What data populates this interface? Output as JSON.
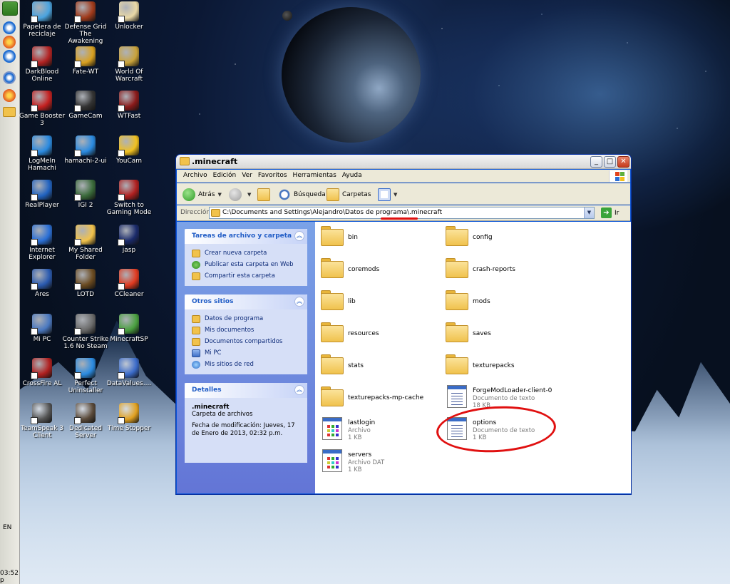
{
  "desktop": {
    "icons": [
      {
        "label": "Papelera de reciclaje",
        "icon": "recycle-bin-icon"
      },
      {
        "label": "Defense Grid The Awakening",
        "icon": "defense-grid-icon"
      },
      {
        "label": "Unlocker",
        "icon": "unlocker-icon"
      },
      {
        "label": "DarkBlood Online",
        "icon": "darkblood-icon"
      },
      {
        "label": "Fate-WT",
        "icon": "fate-icon"
      },
      {
        "label": "World Of Warcraft",
        "icon": "wow-icon"
      },
      {
        "label": "Game Booster 3",
        "icon": "game-booster-icon"
      },
      {
        "label": "GameCam",
        "icon": "gamecam-icon"
      },
      {
        "label": "WTFast",
        "icon": "wtfast-icon"
      },
      {
        "label": "LogMeIn Hamachi",
        "icon": "hamachi-icon"
      },
      {
        "label": "hamachi-2-ui",
        "icon": "hamachi-ui-icon"
      },
      {
        "label": "YouCam",
        "icon": "youcam-icon"
      },
      {
        "label": "RealPlayer",
        "icon": "realplayer-icon"
      },
      {
        "label": "IGI 2",
        "icon": "igi2-icon"
      },
      {
        "label": "Switch to Gaming Mode",
        "icon": "gaming-mode-icon"
      },
      {
        "label": "Internet Explorer",
        "icon": "ie-icon"
      },
      {
        "label": "My Shared Folder",
        "icon": "shared-folder-icon"
      },
      {
        "label": "jasp",
        "icon": "jasp-icon"
      },
      {
        "label": "Ares",
        "icon": "ares-icon"
      },
      {
        "label": "LOTD",
        "icon": "lotd-icon"
      },
      {
        "label": "CCleaner",
        "icon": "ccleaner-icon"
      },
      {
        "label": "Mi PC",
        "icon": "my-computer-icon"
      },
      {
        "label": "Counter Strike 1.6 No Steam",
        "icon": "counter-strike-icon"
      },
      {
        "label": "MinecraftSP",
        "icon": "minecraft-icon"
      },
      {
        "label": "CrossFire AL",
        "icon": "crossfire-icon"
      },
      {
        "label": "Perfect Uninstaller",
        "icon": "uninstaller-icon"
      },
      {
        "label": "DataValues....",
        "icon": "datavalues-icon"
      },
      {
        "label": "TeamSpeak 3 Client",
        "icon": "teamspeak-icon"
      },
      {
        "label": "Dedicated Server",
        "icon": "dedicated-server-icon"
      },
      {
        "label": "Time Stopper",
        "icon": "time-stopper-icon"
      }
    ]
  },
  "quicklaunch": {
    "lang": "EN",
    "time": "03:52 p"
  },
  "window": {
    "title": ".minecraft",
    "menu": [
      "Archivo",
      "Edición",
      "Ver",
      "Favoritos",
      "Herramientas",
      "Ayuda"
    ],
    "toolbar": {
      "back": "Atrás",
      "search": "Búsqueda",
      "folders": "Carpetas"
    },
    "address": {
      "label": "Dirección",
      "path": "C:\\Documents and Settings\\Alejandro\\Datos de programa\\.minecraft",
      "go": "Ir"
    },
    "tasks": {
      "title": "Tareas de archivo y carpeta",
      "items": [
        "Crear nueva carpeta",
        "Publicar esta carpeta en Web",
        "Compartir esta carpeta"
      ]
    },
    "other_places": {
      "title": "Otros sitios",
      "items": [
        "Datos de programa",
        "Mis documentos",
        "Documentos compartidos",
        "Mi PC",
        "Mis sitios de red"
      ]
    },
    "details": {
      "title": "Detalles",
      "name": ".minecraft",
      "type": "Carpeta de archivos",
      "modified": "Fecha de modificación: Jueves, 17 de Enero de 2013, 02:32 p.m."
    },
    "files": [
      {
        "name": "bin",
        "kind": "folder"
      },
      {
        "name": "config",
        "kind": "folder"
      },
      {
        "name": "coremods",
        "kind": "folder"
      },
      {
        "name": "crash-reports",
        "kind": "folder"
      },
      {
        "name": "lib",
        "kind": "folder"
      },
      {
        "name": "mods",
        "kind": "folder"
      },
      {
        "name": "resources",
        "kind": "folder"
      },
      {
        "name": "saves",
        "kind": "folder"
      },
      {
        "name": "stats",
        "kind": "folder"
      },
      {
        "name": "texturepacks",
        "kind": "folder"
      },
      {
        "name": "texturepacks-mp-cache",
        "kind": "folder"
      },
      {
        "name": "ForgeModLoader-client-0",
        "kind": "text",
        "type": "Documento de texto",
        "size": "18 KB"
      },
      {
        "name": "lastlogin",
        "kind": "dat",
        "type": "Archivo",
        "size": "1 KB"
      },
      {
        "name": "options",
        "kind": "text",
        "type": "Documento de texto",
        "size": "1 KB"
      },
      {
        "name": "servers",
        "kind": "dat",
        "type": "Archivo DAT",
        "size": "1 KB"
      }
    ]
  }
}
